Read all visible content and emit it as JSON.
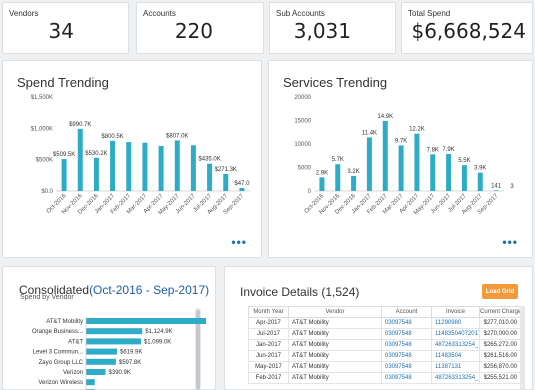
{
  "kpis": [
    {
      "label": "Vendors",
      "value": "34"
    },
    {
      "label": "Accounts",
      "value": "220"
    },
    {
      "label": "Sub Accounts",
      "value": "3,031"
    },
    {
      "label": "Total Spend",
      "value": "$6,668,524"
    }
  ],
  "spend": {
    "title": "Spend Trending",
    "more": "•••",
    "chart_data": {
      "type": "bar",
      "categories": [
        "Oct-2016",
        "Nov-2016",
        "Dec-2016",
        "Jan-2017",
        "Feb-2017",
        "Mar-2017",
        "Apr-2017",
        "May-2017",
        "Jun-2017",
        "Jul-2017",
        "Aug-2017",
        "Sep-2017"
      ],
      "values": [
        509.5,
        990.7,
        530.2,
        800.5,
        780,
        770,
        720,
        807.0,
        730,
        435.0,
        271.3,
        47.0
      ],
      "data_labels": [
        "$509.5K",
        "$990.7K",
        "$530.2K",
        "$800.5K",
        "",
        "",
        "",
        "$807.0K",
        "",
        "$435.0K",
        "$271.3K",
        "$47.0"
      ],
      "yticks": [
        "$0.0",
        "$500K",
        "$1,000K",
        "$1,500K"
      ],
      "ylim": [
        0,
        1500
      ],
      "color": "#2eabc7"
    }
  },
  "services": {
    "title": "Services Trending",
    "more": "•••",
    "chart_data": {
      "type": "bar",
      "categories": [
        "Oct-2016",
        "Nov-2016",
        "Dec-2016",
        "Jan-2017",
        "Feb-2017",
        "Mar-2017",
        "Apr-2017",
        "May-2017",
        "Jun-2017",
        "Jul-2017",
        "Aug-2017",
        "Sep-2017"
      ],
      "values": [
        2900,
        5700,
        3200,
        11400,
        14900,
        9700,
        12200,
        7800,
        7900,
        5500,
        3900,
        141
      ],
      "data_labels": [
        "2.9K",
        "5.7K",
        "3.2K",
        "11.4K",
        "14.9K",
        "9.7K",
        "12.2K",
        "7.8K",
        "7.9K",
        "5.5K",
        "3.9K",
        "141"
      ],
      "extra_label": "3",
      "yticks": [
        "0",
        "5000",
        "10000",
        "15000",
        "20000"
      ],
      "ylim": [
        0,
        20000
      ],
      "color": "#2eabc7"
    }
  },
  "consolidated": {
    "title_prefix": "Consolidated",
    "title_range": "(Oct-2016 - Sep-2017)",
    "subtitle": "Spend by Vendor",
    "chart_data": {
      "type": "bar",
      "categories": [
        "AT&T Mobility",
        "Orange Business...",
        "AT&T",
        "Level 3 Commun...",
        "Zayo Group LLC",
        "Verizon",
        "Verizon Wireless",
        "Verizon Business"
      ],
      "values": [
        2400,
        1124.9,
        1099.0,
        619.9,
        597.8,
        390.9,
        174.7,
        174.7
      ],
      "data_labels": [
        "",
        "$1,124.9K",
        "$1,099.0K",
        "$619.9K",
        "$597.8K",
        "$390.9K",
        "",
        "$174.7K"
      ],
      "color": "#2eabc7"
    }
  },
  "invoice": {
    "title": "Invoice Details (1,524)",
    "load_button": "Load Grid",
    "columns": [
      "Month Year",
      "Vendor",
      "Account",
      "Invoice",
      "Current Charges"
    ],
    "rows": [
      [
        "Apr-2017",
        "AT&T Mobility",
        "03097548",
        "11290980",
        "$277,010.00"
      ],
      [
        "Jul-2017",
        "AT&T Mobility",
        "03097548",
        "11483504072017",
        "$270,000.00"
      ],
      [
        "Jan-2017",
        "AT&T Mobility",
        "03097548",
        "487263313254_...",
        "$265,272.00"
      ],
      [
        "Jun-2017",
        "AT&T Mobility",
        "03097548",
        "11483504",
        "$261,516.00"
      ],
      [
        "May-2017",
        "AT&T Mobility",
        "03097548",
        "11387131",
        "$256,870.00"
      ],
      [
        "Feb-2017",
        "AT&T Mobility",
        "03097548",
        "487263313254_...",
        "$255,521.00"
      ]
    ]
  }
}
